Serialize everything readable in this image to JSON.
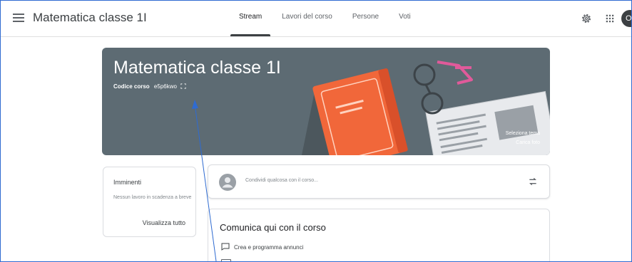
{
  "header": {
    "title": "Matematica classe 1I",
    "tabs": [
      {
        "label": "Stream",
        "active": true
      },
      {
        "label": "Lavori del corso",
        "active": false
      },
      {
        "label": "Persone",
        "active": false
      },
      {
        "label": "Voti",
        "active": false
      }
    ],
    "avatar_initial": "O",
    "icons": [
      "menu-icon",
      "gear-icon",
      "apps-grid-icon"
    ]
  },
  "banner": {
    "title": "Matematica classe 1I",
    "code_label": "Codice corso",
    "code_value": "e5p6kwo",
    "select_theme": "Seleziona tema",
    "upload_photo": "Carica foto",
    "color": "#5d6b73"
  },
  "upcoming": {
    "title": "Imminenti",
    "text": "Nessun lavoro in scadenza a breve",
    "view_all": "Visualizza tutto"
  },
  "share": {
    "placeholder": "Condividi qualcosa con il corso..."
  },
  "communicate": {
    "title": "Comunica qui con il corso",
    "item1": "Crea e programma annunci"
  },
  "colors": {
    "accent_annotation": "#2f6bd1",
    "book": "#f1673a",
    "glasses": "#e05a9a"
  }
}
